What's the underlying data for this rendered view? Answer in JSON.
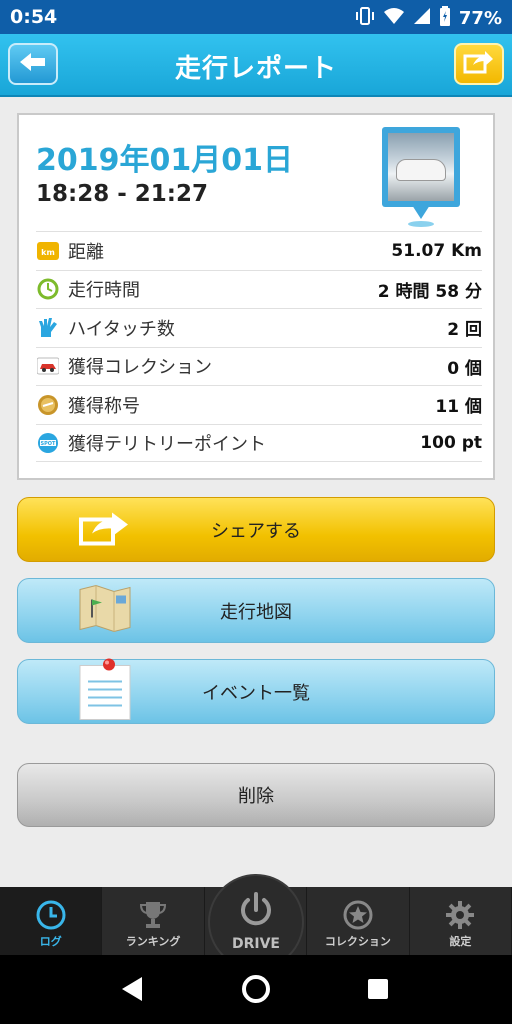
{
  "status_bar": {
    "time": "0:54",
    "battery": "77%",
    "icons": [
      "vibrate-icon",
      "wifi-icon",
      "signal-icon",
      "battery-icon"
    ]
  },
  "header": {
    "title": "走行レポート",
    "back_icon": "back-arrow-icon",
    "share_icon": "share-icon",
    "accent": "#1fb0e3"
  },
  "report": {
    "date": "2019年01月01日",
    "time_range": "18:28 - 21:27",
    "photo": "car-photo",
    "rows": [
      {
        "icon": "km-icon",
        "label": "距離",
        "value": "51.07 Km"
      },
      {
        "icon": "clock-icon",
        "label": "走行時間",
        "value": "2 時間 58 分"
      },
      {
        "icon": "hi-five-icon",
        "label": "ハイタッチ数",
        "value": "2 回"
      },
      {
        "icon": "car-collection-icon",
        "label": "獲得コレクション",
        "value": "0 個"
      },
      {
        "icon": "title-medal-icon",
        "label": "獲得称号",
        "value": "11 個"
      },
      {
        "icon": "spot-icon",
        "label": "獲得テリトリーポイント",
        "value": "100 pt"
      }
    ]
  },
  "actions": {
    "share": "シェアする",
    "map": "走行地図",
    "events": "イベント一覧",
    "delete": "削除"
  },
  "bottom_nav": {
    "items": [
      {
        "label": "ログ",
        "icon": "clock-icon",
        "active": true
      },
      {
        "label": "ランキング",
        "icon": "trophy-icon",
        "active": false
      },
      {
        "label": "DRIVE",
        "icon": "power-icon",
        "active": false
      },
      {
        "label": "コレクション",
        "icon": "star-icon",
        "active": false
      },
      {
        "label": "設定",
        "icon": "gear-icon",
        "active": false
      }
    ]
  },
  "system_nav": [
    "back-triangle-icon",
    "home-circle-icon",
    "recents-square-icon"
  ]
}
